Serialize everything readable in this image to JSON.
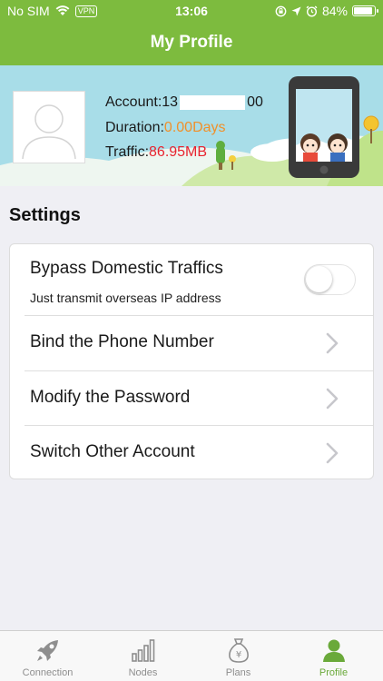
{
  "status_bar": {
    "carrier": "No SIM",
    "vpn": "VPN",
    "time": "13:06",
    "battery": "84%",
    "battery_level": 0.84
  },
  "header": {
    "title": "My Profile"
  },
  "profile": {
    "account_label": "Account:",
    "account_prefix": "13",
    "account_suffix": "00",
    "duration_label": "Duration:",
    "duration_value": "0.00Days",
    "traffic_label": "Traffic:",
    "traffic_value": "86.95MB"
  },
  "settings": {
    "title": "Settings",
    "bypass": {
      "label": "Bypass Domestic Traffics",
      "sublabel": "Just transmit overseas IP address",
      "enabled": false
    },
    "items": [
      {
        "label": "Bind the Phone Number"
      },
      {
        "label": "Modify the Password"
      },
      {
        "label": "Switch Other Account"
      }
    ]
  },
  "tab_bar": {
    "tabs": [
      {
        "label": "Connection",
        "icon": "rocket-icon"
      },
      {
        "label": "Nodes",
        "icon": "signal-bars-icon"
      },
      {
        "label": "Plans",
        "icon": "money-bag-icon"
      },
      {
        "label": "Profile",
        "icon": "person-icon"
      }
    ],
    "active": "Profile"
  },
  "colors": {
    "brand_green": "#7dbb3e",
    "duration_orange": "#f0902a",
    "traffic_red": "#e8232f",
    "active_tab": "#6aa93a",
    "banner_sky": "#a8dde8"
  }
}
